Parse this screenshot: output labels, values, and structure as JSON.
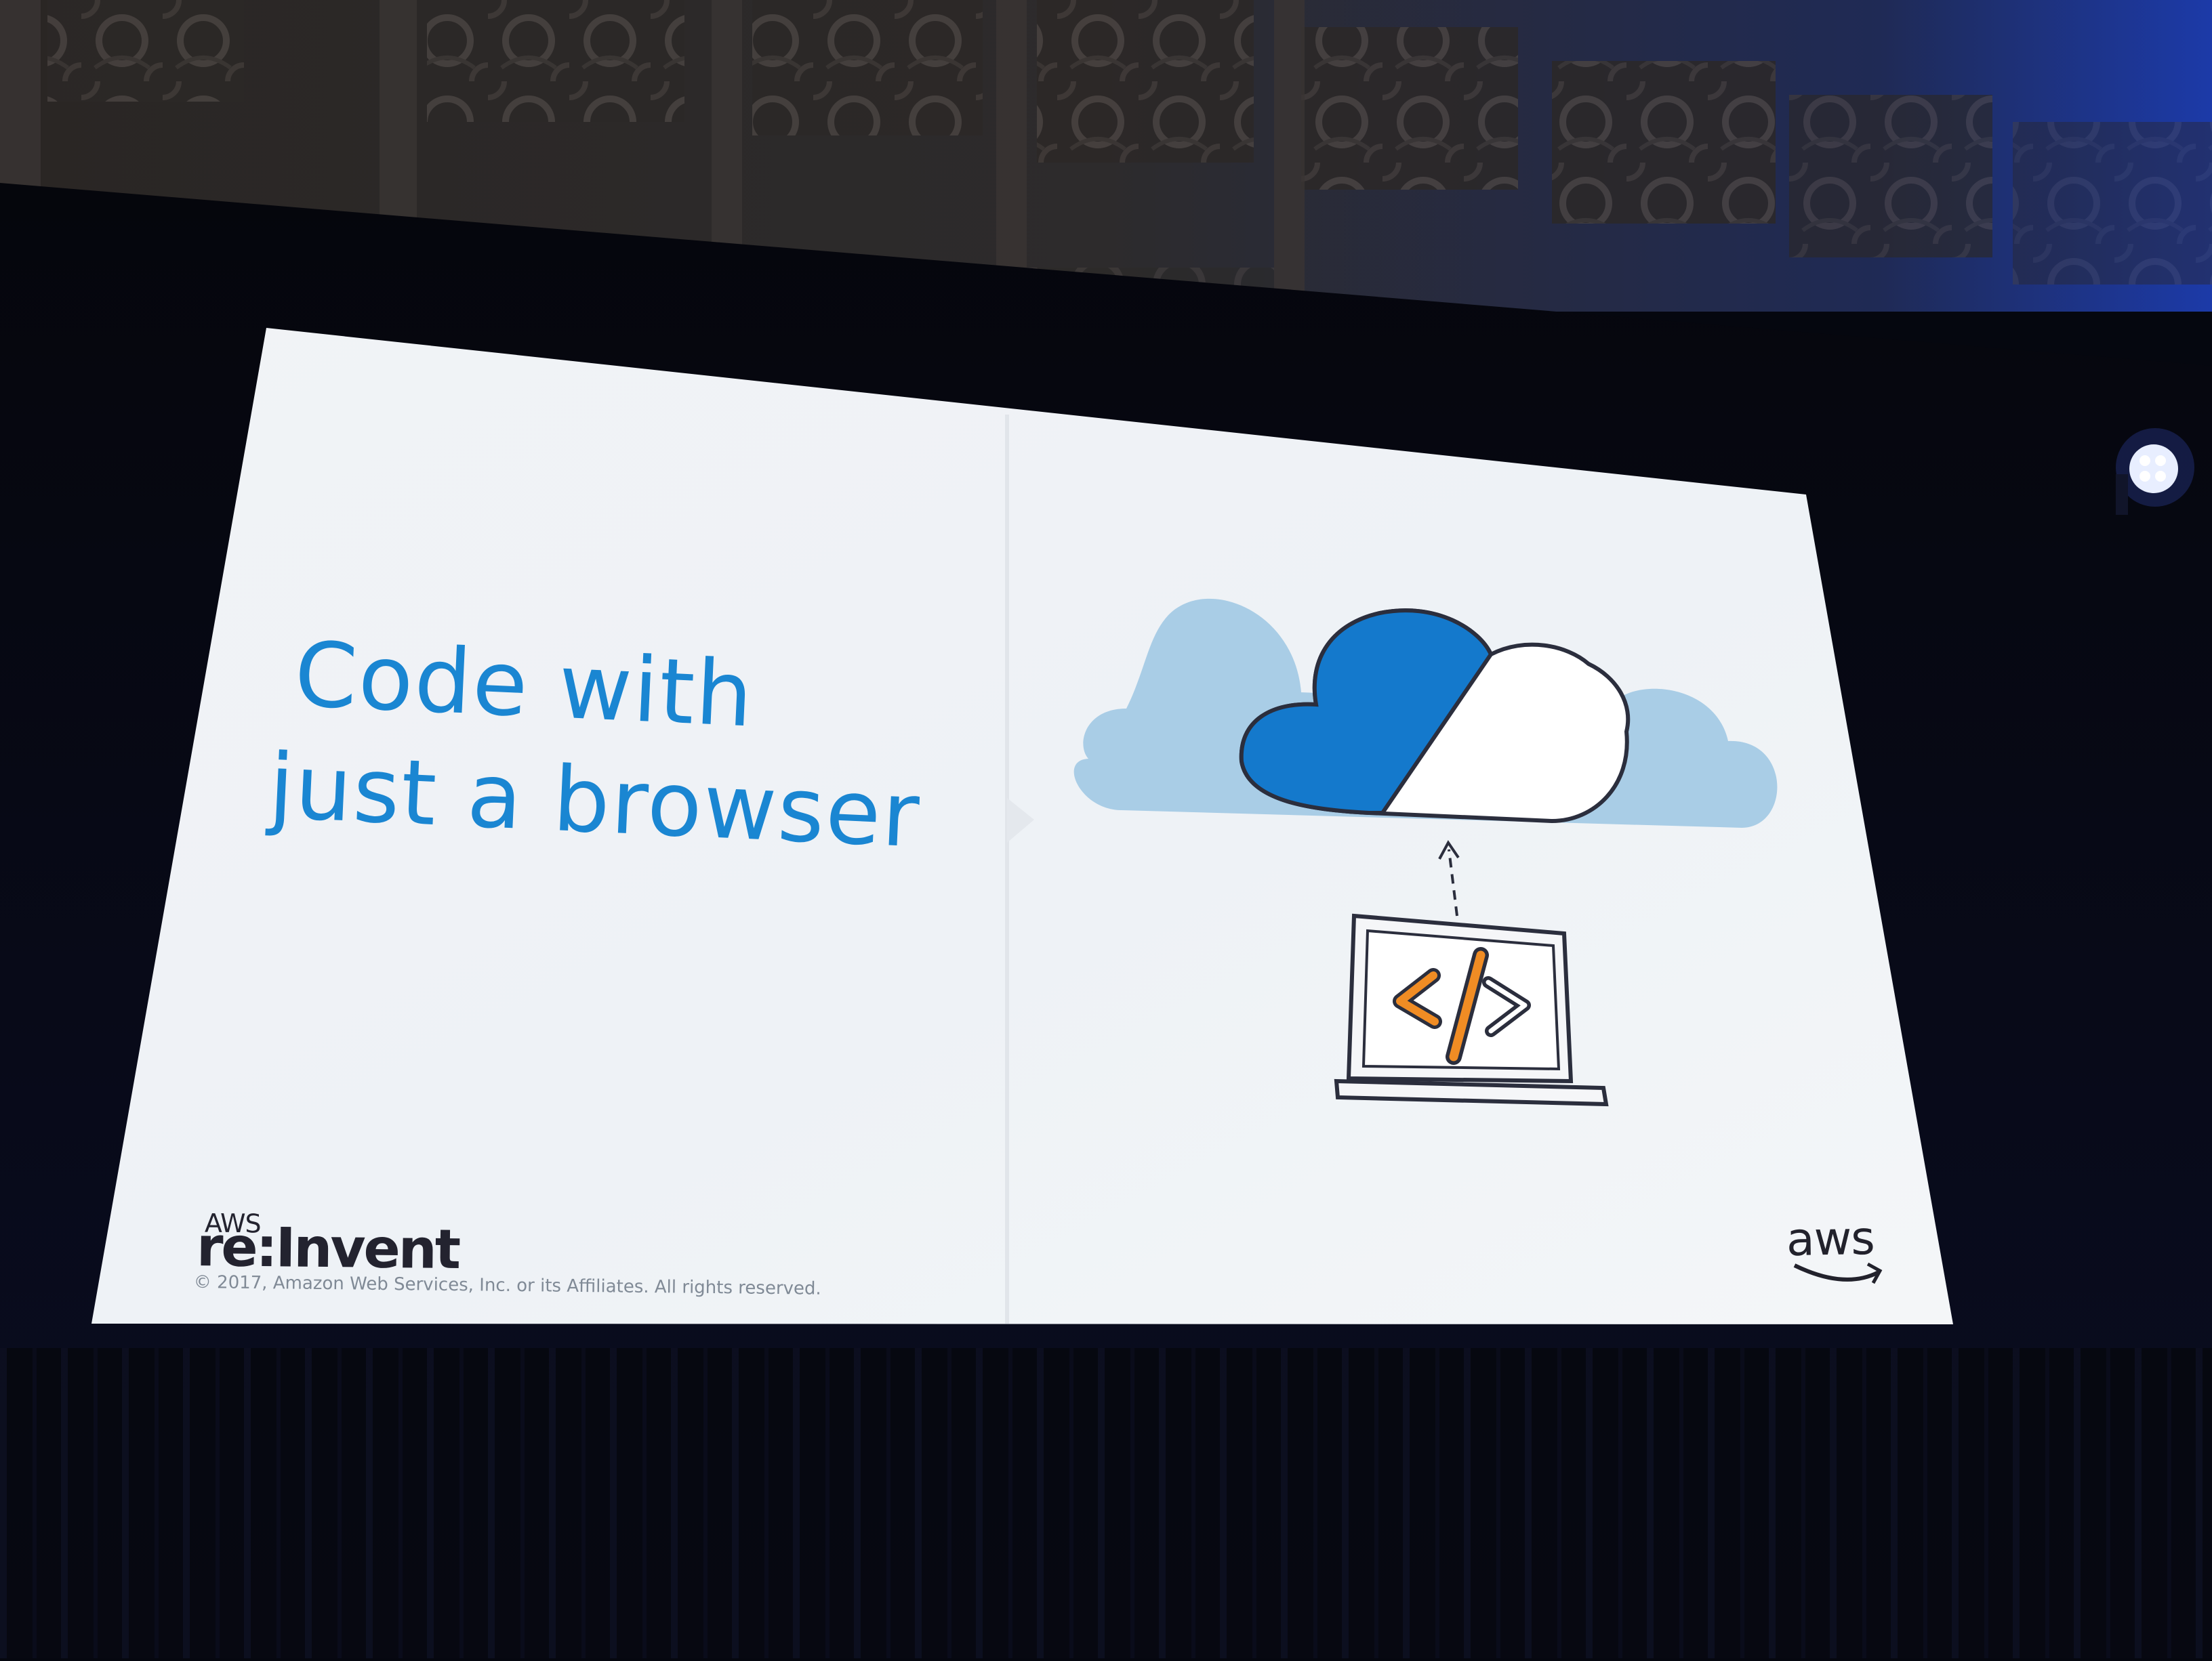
{
  "slide": {
    "title_line_1": "Code with",
    "title_line_2": "just a browser",
    "footer_logo_small": "AWS",
    "footer_logo_main": "re:Invent",
    "copyright": "© 2017, Amazon Web Services, Inc. or its Affiliates. All rights reserved.",
    "brand_word": "aws",
    "code_symbol": "</>"
  },
  "colors": {
    "title": "#1a86d2",
    "cloud_front_blue": "#1479cc",
    "cloud_back_blue": "#a9cde6",
    "code_orange": "#f08c24",
    "slide_background": "#f2f5f8",
    "stage_background": "#05070f"
  },
  "icons": [
    "cloud-icon",
    "laptop-icon",
    "code-icon",
    "upload-arrow-icon",
    "aws-smile-icon"
  ]
}
